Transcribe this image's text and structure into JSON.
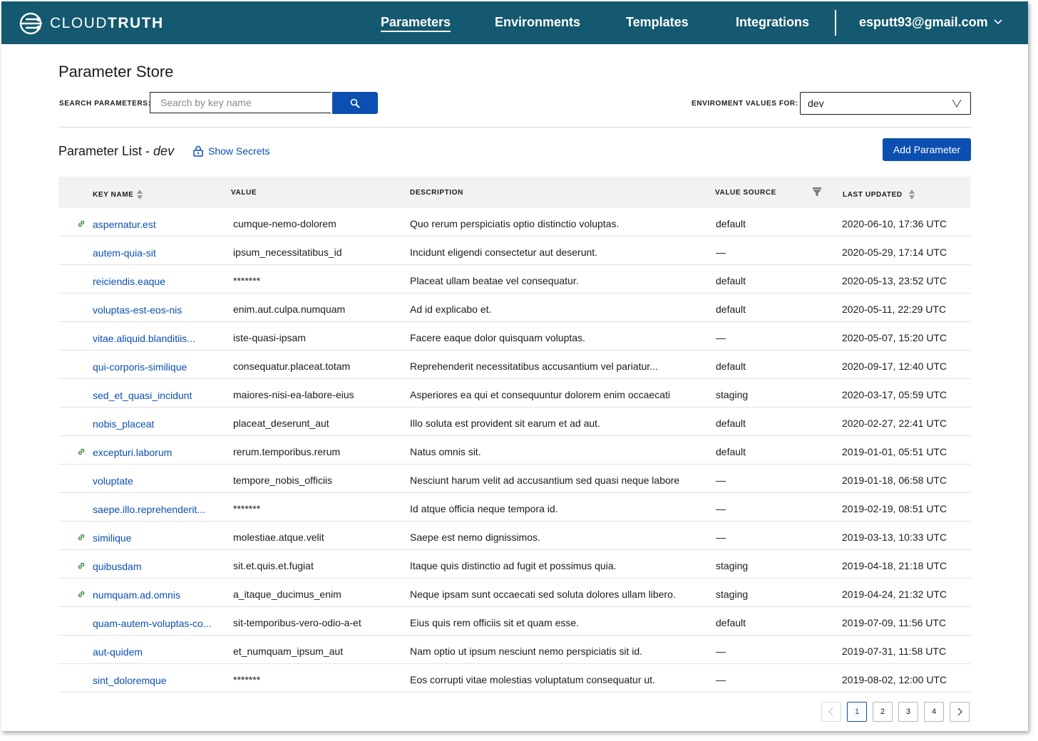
{
  "brand": {
    "logo_bold": "CLOUD",
    "logo_light": "TRUTH"
  },
  "nav": {
    "items": [
      {
        "label": "Parameters",
        "active": true
      },
      {
        "label": "Environments"
      },
      {
        "label": "Templates"
      },
      {
        "label": "Integrations"
      }
    ],
    "user": "esputt93@gmail.com"
  },
  "page": {
    "title": "Parameter Store",
    "search_label": "SEARCH PARAMETERS:",
    "search_placeholder": "Search by key name",
    "env_label": "ENVIROMENT VALUES FOR:",
    "env_value": "dev",
    "list_title": "Parameter List - ",
    "list_env": "dev",
    "show_secrets": "Show Secrets",
    "add_button": "Add Parameter"
  },
  "table": {
    "headers": {
      "key": "KEY NAME",
      "value": "VALUE",
      "description": "DESCRIPTION",
      "source": "VALUE SOURCE",
      "updated": "LAST UPDATED"
    },
    "rows": [
      {
        "linked": true,
        "key": "aspernatur.est",
        "value": "cumque-nemo-dolorem",
        "description": "Quo rerum perspiciatis optio distinctio voluptas.",
        "source": "default",
        "updated": "2020-06-10, 17:36 UTC"
      },
      {
        "linked": false,
        "key": "autem-quia-sit",
        "value": "ipsum_necessitatibus_id",
        "description": "Incidunt eligendi consectetur aut deserunt.",
        "source": "—",
        "updated": "2020-05-29, 17:14 UTC"
      },
      {
        "linked": false,
        "key": "reiciendis.eaque",
        "value": "*******",
        "description": "Placeat ullam beatae vel consequatur.",
        "source": "default",
        "updated": "2020-05-13, 23:52 UTC"
      },
      {
        "linked": false,
        "key": "voluptas-est-eos-nis",
        "value": "enim.aut.culpa.numquam",
        "description": "Ad id explicabo et.",
        "source": "default",
        "updated": "2020-05-11, 22:29 UTC"
      },
      {
        "linked": false,
        "key": "vitae.aliquid.blanditiis...",
        "value": "iste-quasi-ipsam",
        "description": "Facere eaque dolor quisquam voluptas.",
        "source": "—",
        "updated": "2020-05-07, 15:20 UTC"
      },
      {
        "linked": false,
        "key": "qui-corporis-similique",
        "value": "consequatur.placeat.totam",
        "description": "Reprehenderit necessitatibus accusantium vel pariatur...",
        "source": "default",
        "updated": "2020-09-17, 12:40 UTC"
      },
      {
        "linked": false,
        "key": "sed_et_quasi_incidunt",
        "value": "maiores-nisi-ea-labore-eius",
        "description": "Asperiores ea qui et consequuntur dolorem enim occaecati",
        "source": "staging",
        "updated": "2020-03-17, 05:59 UTC"
      },
      {
        "linked": false,
        "key": "nobis_placeat",
        "value": "placeat_deserunt_aut",
        "description": "Illo soluta est provident sit earum et ad aut.",
        "source": "default",
        "updated": "2020-02-27, 22:41 UTC"
      },
      {
        "linked": true,
        "key": "excepturi.laborum",
        "value": "rerum.temporibus.rerum",
        "description": "Natus omnis sit.",
        "source": "default",
        "updated": "2019-01-01, 05:51 UTC"
      },
      {
        "linked": false,
        "key": "voluptate",
        "value": "tempore_nobis_officiis",
        "description": "Nesciunt harum velit ad accusantium sed quasi neque labore",
        "source": "—",
        "updated": "2019-01-18, 06:58 UTC"
      },
      {
        "linked": false,
        "key": "saepe.illo.reprehenderit...",
        "value": "*******",
        "description": "Id atque officia neque tempora id.",
        "source": "—",
        "updated": "2019-02-19, 08:51 UTC"
      },
      {
        "linked": true,
        "key": "similique",
        "value": "molestiae.atque.velit",
        "description": "Saepe est nemo dignissimos.",
        "source": "—",
        "updated": "2019-03-13, 10:33 UTC"
      },
      {
        "linked": true,
        "key": "quibusdam",
        "value": "sit.et.quis.et.fugiat",
        "description": "Itaque quis distinctio ad fugit et possimus quia.",
        "source": "staging",
        "updated": "2019-04-18, 21:18 UTC"
      },
      {
        "linked": true,
        "key": "numquam.ad.omnis",
        "value": "a_itaque_ducimus_enim",
        "description": "Neque ipsam sunt occaecati sed soluta dolores ullam libero.",
        "source": "staging",
        "updated": "2019-04-24, 21:32 UTC"
      },
      {
        "linked": false,
        "key": "quam-autem-voluptas-co...",
        "value": "sit-temporibus-vero-odio-a-et",
        "description": "Eius quis rem officiis sit et quam esse.",
        "source": "default",
        "updated": "2019-07-09, 11:56 UTC"
      },
      {
        "linked": false,
        "key": "aut-quidem",
        "value": "et_numquam_ipsum_aut",
        "description": "Nam optio ut ipsum nesciunt nemo perspiciatis sit id.",
        "source": "—",
        "updated": "2019-07-31, 11:58 UTC"
      },
      {
        "linked": false,
        "key": "sint_doloremque",
        "value": "*******",
        "description": "Eos corrupti vitae molestias voluptatum consequatur ut.",
        "source": "—",
        "updated": "2019-08-02, 12:00 UTC"
      }
    ]
  },
  "pagination": {
    "pages": [
      "1",
      "2",
      "3",
      "4"
    ],
    "current": "1"
  },
  "colors": {
    "header_bg": "#14596f",
    "primary": "#0b4fb0",
    "link": "#0b4fb0",
    "link_icon": "#2e7d32"
  },
  "icons": {
    "prev": "chevron-left-icon",
    "next": "chevron-right-icon",
    "search": "magnifier-icon",
    "lock": "lock-icon",
    "filter": "filter-icon",
    "sort": "sort-icon",
    "link": "link-icon"
  }
}
